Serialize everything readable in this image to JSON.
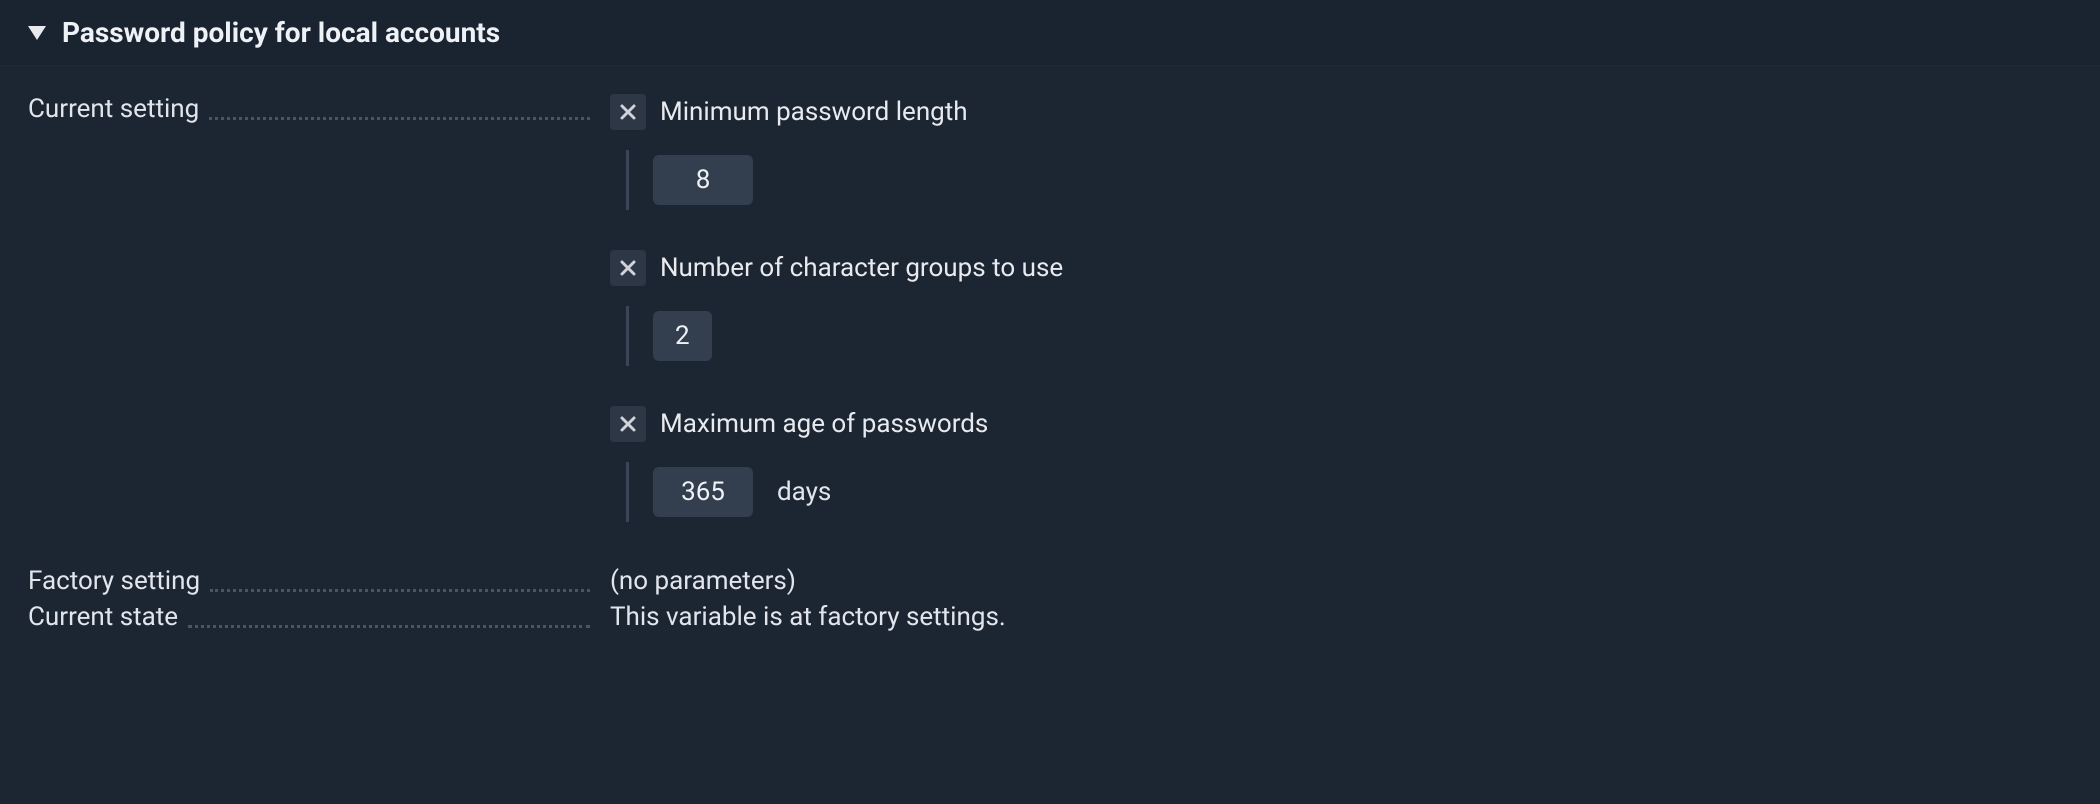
{
  "header": {
    "title": "Password policy for local accounts"
  },
  "current_setting": {
    "label": "Current setting",
    "params": [
      {
        "label": "Minimum password length",
        "value": "8",
        "unit": "",
        "narrow": false
      },
      {
        "label": "Number of character groups to use",
        "value": "2",
        "unit": "",
        "narrow": true
      },
      {
        "label": "Maximum age of passwords",
        "value": "365",
        "unit": "days",
        "narrow": false
      }
    ]
  },
  "factory_setting": {
    "label": "Factory setting",
    "value": "(no parameters)"
  },
  "current_state": {
    "label": "Current state",
    "value": "This variable is at factory settings."
  }
}
